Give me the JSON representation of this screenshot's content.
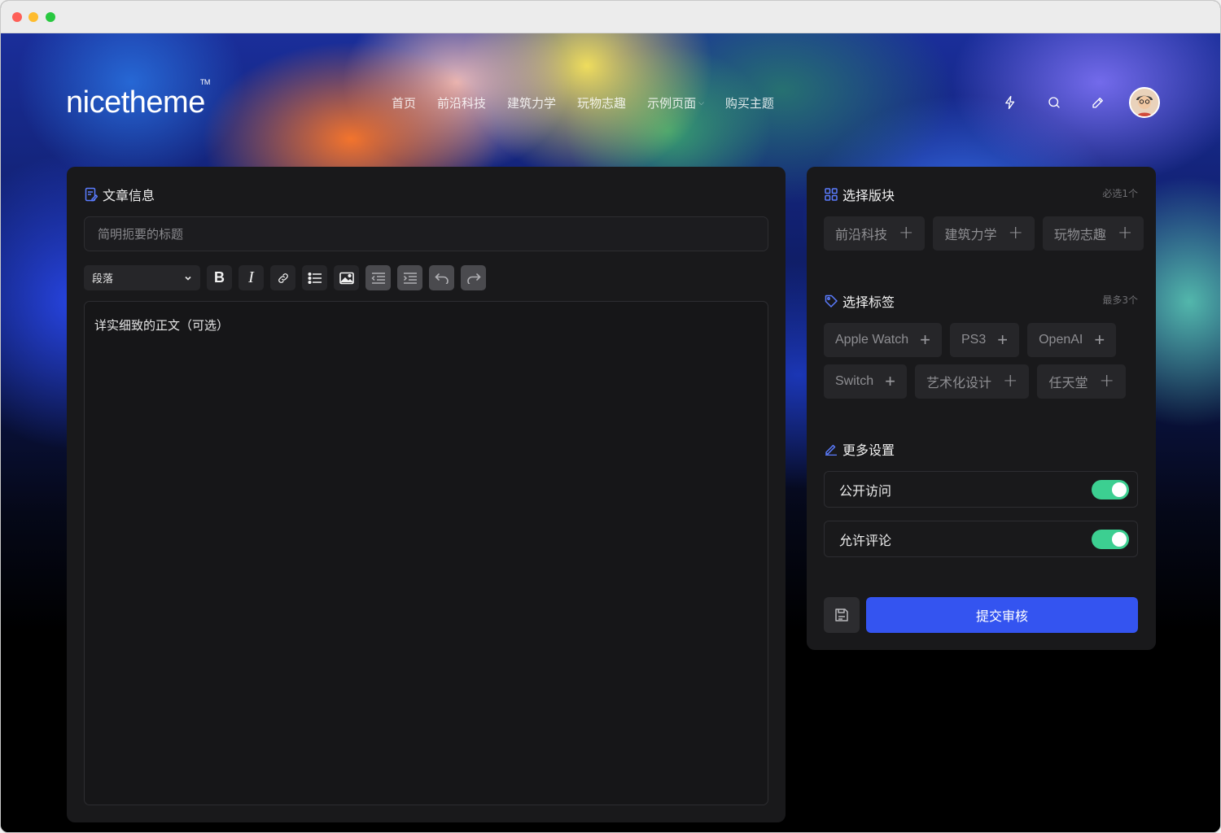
{
  "brand": {
    "logo": "nicetheme",
    "tm": "TM"
  },
  "nav": {
    "items": [
      {
        "label": "首页"
      },
      {
        "label": "前沿科技"
      },
      {
        "label": "建筑力学"
      },
      {
        "label": "玩物志趣"
      },
      {
        "label": "示例页面",
        "has_dropdown": true
      },
      {
        "label": "购买主题"
      }
    ]
  },
  "header_icons": [
    "flash-icon",
    "search-icon",
    "pencil-icon",
    "avatar"
  ],
  "article": {
    "section_title": "文章信息",
    "title_placeholder": "简明扼要的标题",
    "editor_placeholder": "详实细致的正文（可选）",
    "format_select": "段落",
    "toolbar": [
      "bold",
      "italic",
      "link",
      "bullet-list",
      "image",
      "outdent",
      "indent",
      "undo",
      "redo"
    ]
  },
  "board": {
    "section_title": "选择版块",
    "hint": "必选1个",
    "options": [
      {
        "label": "前沿科技"
      },
      {
        "label": "建筑力学"
      },
      {
        "label": "玩物志趣"
      }
    ]
  },
  "tags": {
    "section_title": "选择标签",
    "hint": "最多3个",
    "options": [
      {
        "label": "Apple Watch"
      },
      {
        "label": "PS3"
      },
      {
        "label": "OpenAI"
      },
      {
        "label": "Switch"
      },
      {
        "label": "艺术化设计"
      },
      {
        "label": "任天堂"
      }
    ]
  },
  "settings": {
    "section_title": "更多设置",
    "public_access": {
      "label": "公开访问",
      "enabled": true
    },
    "allow_comments": {
      "label": "允许评论",
      "enabled": true
    }
  },
  "actions": {
    "submit": "提交审核"
  },
  "colors": {
    "accent": "#3454f0",
    "toggle_on": "#3ccf91",
    "panel_bg": "#19191b"
  }
}
